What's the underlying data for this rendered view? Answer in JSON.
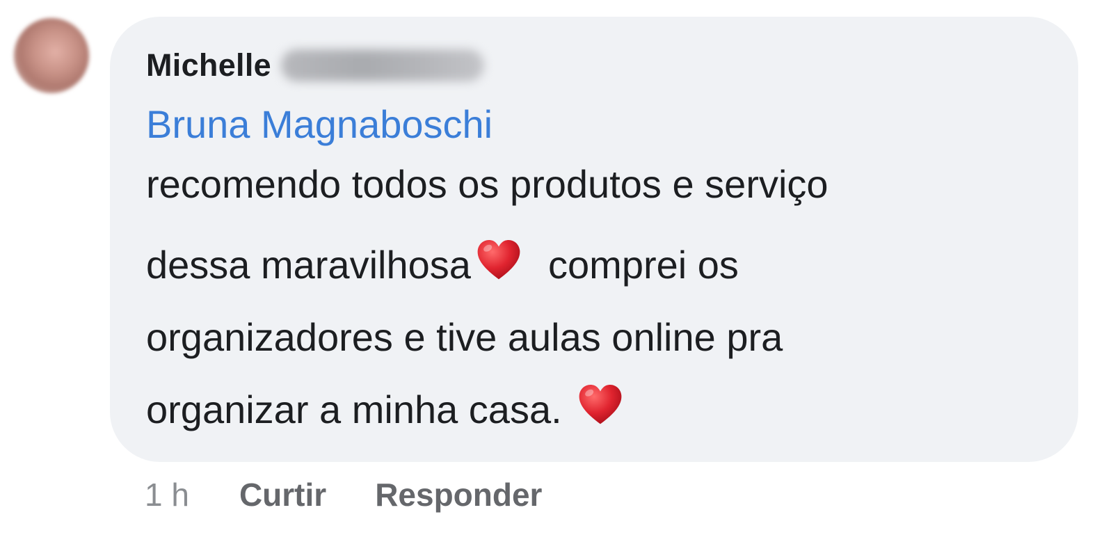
{
  "comment": {
    "author_first_name": "Michelle",
    "author_surname": "",
    "mention": "Bruna Magnaboschi",
    "lines": [
      "recomendo todos os produtos e serviço",
      "dessa maravilhosa",
      "comprei os",
      "organizadores e tive aulas online pra",
      "organizar a minha casa."
    ],
    "emoji": "heart-emoji"
  },
  "actions": {
    "time": "1 h",
    "like_label": "Curtir",
    "reply_label": "Responder"
  },
  "colors": {
    "bubble": "#f0f2f5",
    "mention": "#3b7ed8",
    "text": "#1c1e21",
    "action": "#65676b",
    "heart": "#e0242f"
  }
}
